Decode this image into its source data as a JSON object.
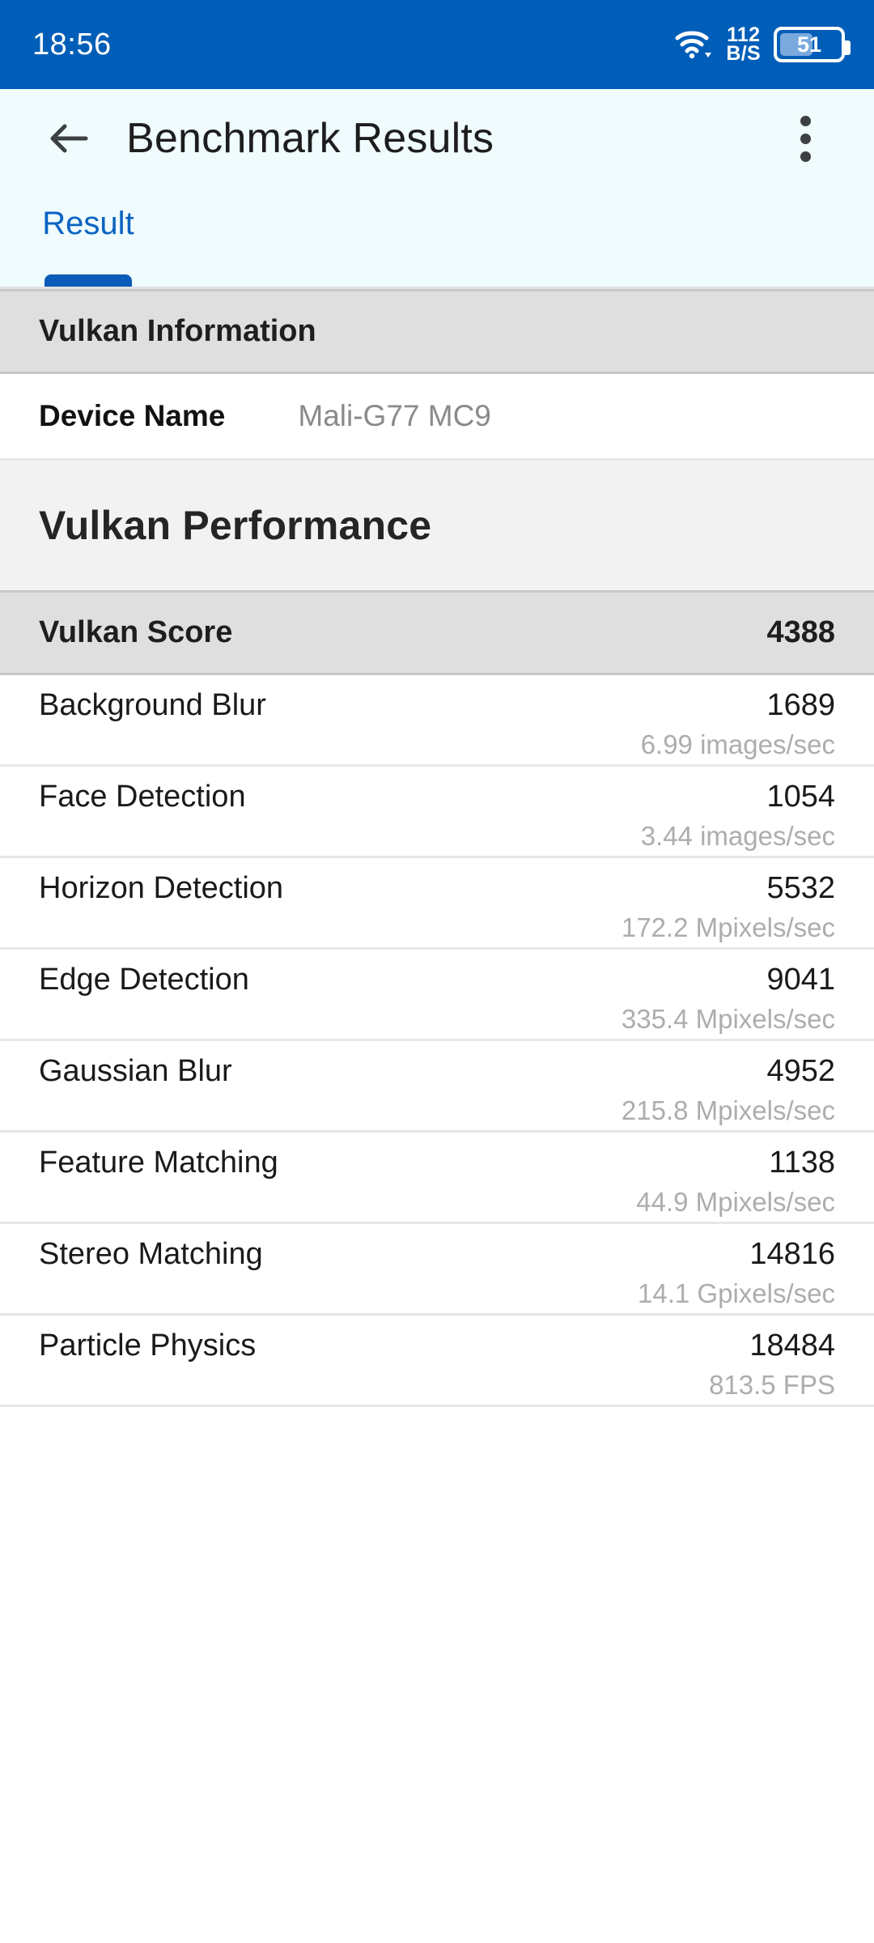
{
  "status_bar": {
    "time": "18:56",
    "wifi_icon": "wifi-icon",
    "data_rate_value": "112",
    "data_rate_unit": "B/S",
    "battery_percent": "51",
    "bg_color": "#005eb8"
  },
  "app_bar": {
    "back_icon": "back-arrow-icon",
    "title": "Benchmark Results",
    "overflow_icon": "more-vertical-icon",
    "bg_color": "#effbfd"
  },
  "tabs": {
    "items": [
      {
        "label": "Result",
        "selected": true
      }
    ],
    "accent_color": "#0a5cb8"
  },
  "sections": {
    "vulkan_information": {
      "header": "Vulkan Information",
      "rows": [
        {
          "key": "Device Name",
          "value": "Mali-G77 MC9"
        }
      ]
    },
    "vulkan_performance": {
      "heading": "Vulkan Performance",
      "score_label": "Vulkan Score",
      "score_value": "4388",
      "benchmarks": [
        {
          "name": "Background Blur",
          "score": "1689",
          "rate": "6.99 images/sec"
        },
        {
          "name": "Face Detection",
          "score": "1054",
          "rate": "3.44 images/sec"
        },
        {
          "name": "Horizon Detection",
          "score": "5532",
          "rate": "172.2 Mpixels/sec"
        },
        {
          "name": "Edge Detection",
          "score": "9041",
          "rate": "335.4 Mpixels/sec"
        },
        {
          "name": "Gaussian Blur",
          "score": "4952",
          "rate": "215.8 Mpixels/sec"
        },
        {
          "name": "Feature Matching",
          "score": "1138",
          "rate": "44.9 Mpixels/sec"
        },
        {
          "name": "Stereo Matching",
          "score": "14816",
          "rate": "14.1 Gpixels/sec"
        },
        {
          "name": "Particle Physics",
          "score": "18484",
          "rate": "813.5 FPS"
        }
      ]
    }
  }
}
